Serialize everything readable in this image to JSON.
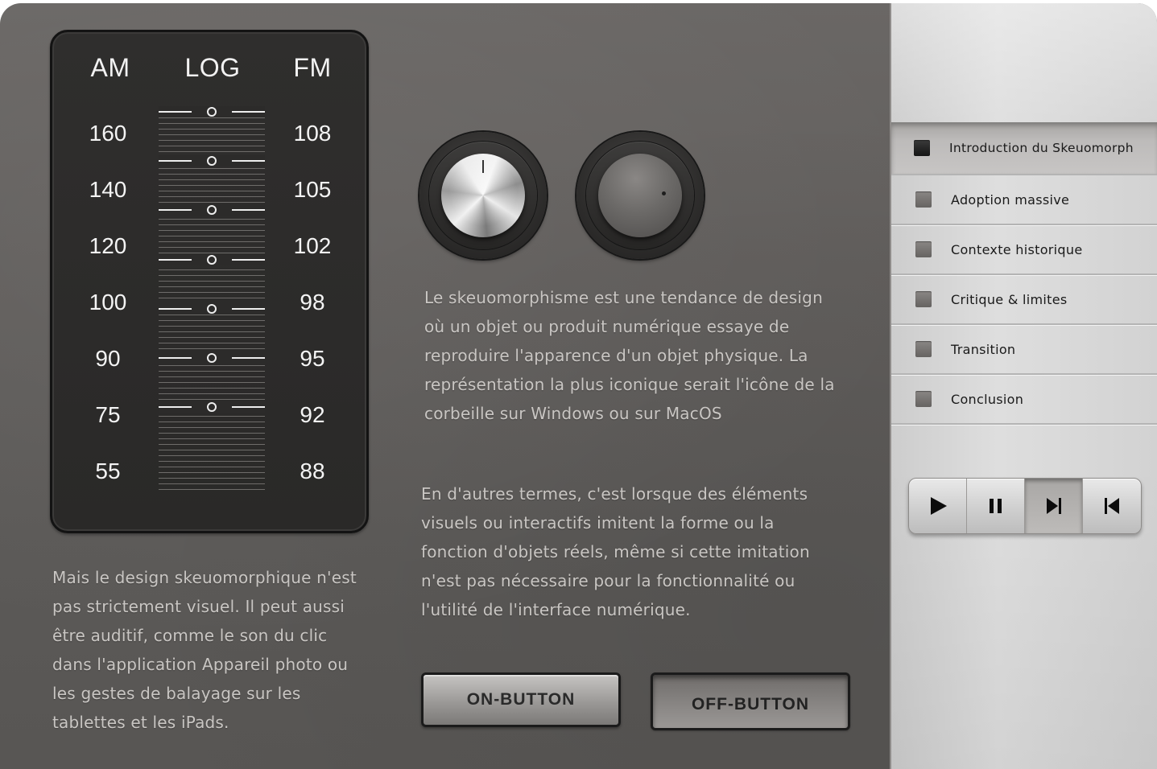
{
  "dial": {
    "headers": {
      "am": "AM",
      "log": "LOG",
      "fm": "FM"
    },
    "am_values": [
      "160",
      "140",
      "120",
      "100",
      "90",
      "75",
      "55"
    ],
    "fm_values": [
      "108",
      "105",
      "102",
      "98",
      "95",
      "92",
      "88"
    ]
  },
  "content": {
    "paragraph_main": [
      "Le skeuomorphisme est une tendance de design",
      "où un objet ou produit numérique essaye de",
      "reproduire l'apparence d'un objet physique. La",
      "représentation la plus iconique serait l'icône de la",
      "corbeille sur Windows ou sur MacOS"
    ],
    "paragraph_second": [
      "En d'autres termes, c'est lorsque des éléments",
      "visuels ou interactifs imitent la forme ou la",
      "fonction d'objets réels, même si cette imitation",
      "n'est pas nécessaire pour la fonctionnalité ou",
      "l'utilité de l'interface numérique."
    ],
    "paragraph_left": [
      "Mais le design skeuomorphique n'est",
      "pas strictement visuel. Il peut aussi",
      "être auditif, comme le son du clic",
      "dans l'application Appareil photo ou",
      "les gestes de balayage sur les",
      "tablettes et les iPads."
    ]
  },
  "buttons": {
    "on_label": "ON-BUTTON",
    "off_label": "OFF-BUTTON"
  },
  "menu": {
    "items": [
      {
        "label": "Introduction du Skeuomorph",
        "active": true
      },
      {
        "label": "Adoption massive",
        "active": false
      },
      {
        "label": "Contexte historique",
        "active": false
      },
      {
        "label": "Critique & limites",
        "active": false
      },
      {
        "label": "Transition",
        "active": false
      },
      {
        "label": "Conclusion",
        "active": false
      }
    ]
  },
  "transport": {
    "buttons": [
      {
        "icon": "play-icon",
        "pressed": false
      },
      {
        "icon": "pause-icon",
        "pressed": false
      },
      {
        "icon": "skip-next-icon",
        "pressed": true
      },
      {
        "icon": "skip-previous-icon",
        "pressed": false
      }
    ]
  },
  "colors": {
    "background": "#615e5c",
    "dial_face": "#2c2b2a",
    "panel": "#d8d8d8",
    "text_light": "#c9c6c3"
  }
}
